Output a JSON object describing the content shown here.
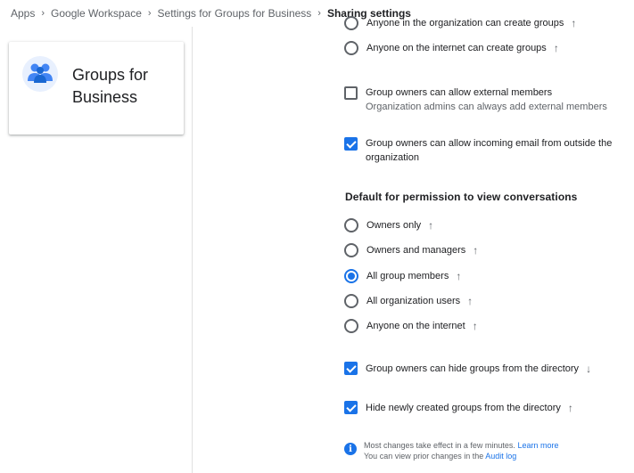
{
  "breadcrumb": {
    "items": [
      "Apps",
      "Google Workspace",
      "Settings for Groups for Business"
    ],
    "current": "Sharing settings",
    "separator": "›"
  },
  "app": {
    "name": "Groups for Business",
    "icon": "groups-icon"
  },
  "creation_options": [
    {
      "label": "Anyone in the organization can create groups",
      "checked": false,
      "arrow": "↑"
    },
    {
      "label": "Anyone on the internet can create groups",
      "checked": false,
      "arrow": "↑"
    }
  ],
  "external_members": {
    "label": "Group owners can allow external members",
    "sub": "Organization admins can always add external members",
    "checked": false
  },
  "incoming_email": {
    "label": "Group owners can allow incoming email from outside the",
    "label2": "organization",
    "checked": true
  },
  "view_permission": {
    "title": "Default for permission to view conversations",
    "options": [
      {
        "label": "Owners only",
        "checked": false,
        "arrow": "↑"
      },
      {
        "label": "Owners and managers",
        "checked": false,
        "arrow": "↑"
      },
      {
        "label": "All group members",
        "checked": true,
        "arrow": "↑"
      },
      {
        "label": "All organization users",
        "checked": false,
        "arrow": "↑"
      },
      {
        "label": "Anyone on the internet",
        "checked": false,
        "arrow": "↑"
      }
    ]
  },
  "hide_groups": {
    "label": "Group owners can hide groups from the directory",
    "checked": true,
    "arrow": "↓"
  },
  "hide_new": {
    "label": "Hide newly created groups from the directory",
    "checked": true,
    "arrow": "↑"
  },
  "info": {
    "line1": "Most changes take effect in a few minutes.",
    "learn_more": "Learn more",
    "line2": "You can view prior changes in the",
    "audit_log": "Audit log"
  },
  "colors": {
    "accent": "#1a73e8",
    "text": "#202124",
    "secondary": "#5f6368"
  }
}
